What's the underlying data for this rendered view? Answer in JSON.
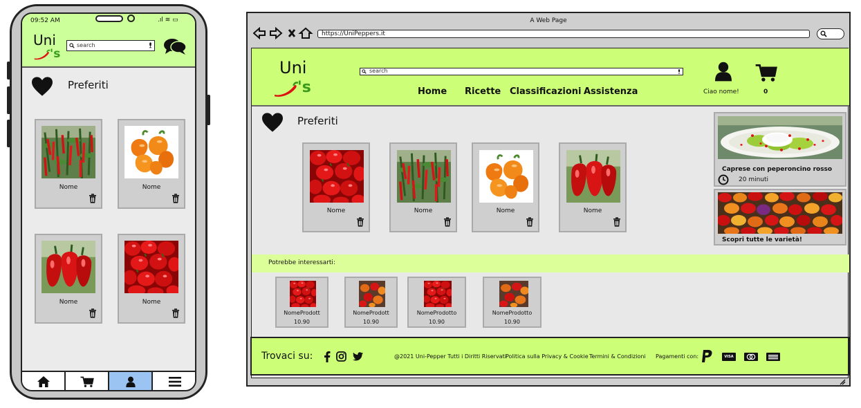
{
  "phone": {
    "status_time": "09:52 AM",
    "logo": {
      "top": "Uni",
      "bottom": "'s"
    },
    "search_placeholder": "search",
    "page_title": "Preferiti",
    "favorites": [
      {
        "name": "Nome",
        "image": "pepper-plant"
      },
      {
        "name": "Nome",
        "image": "orange-habanero"
      },
      {
        "name": "Nome",
        "image": "red-habanero"
      },
      {
        "name": "Nome",
        "image": "red-peppers-pile"
      }
    ],
    "bottom_nav": [
      "home-icon",
      "cart-icon",
      "user-icon",
      "menu-icon"
    ]
  },
  "browser": {
    "window_title": "A Web Page",
    "url": "https://UniPeppers.it",
    "logo": {
      "top": "Uni",
      "bottom": "'s"
    },
    "search_placeholder": "search",
    "nav": [
      "Home",
      "Ricette",
      "Classificazioni",
      "Assistenza"
    ],
    "user_greeting": "Ciao nome!",
    "cart_count": "0",
    "page_title": "Preferiti",
    "favorites": [
      {
        "name": "Nome",
        "image": "red-peppers-pile"
      },
      {
        "name": "Nome",
        "image": "pepper-plant"
      },
      {
        "name": "Nome",
        "image": "orange-habanero"
      },
      {
        "name": "Nome",
        "image": "red-habanero"
      }
    ],
    "sidebar": [
      {
        "title": "Caprese con peperoncino rosso",
        "time": "20 minuti",
        "image": "caprese-dish"
      },
      {
        "title": "Scopri tutte le varietà!",
        "image": "mixed-peppers"
      }
    ],
    "suggestions_title": "Potrebbe interessarti:",
    "suggestions": [
      {
        "name": "NomeProdott",
        "price": "10.90"
      },
      {
        "name": "NomeProdott",
        "price": "10.90"
      },
      {
        "name": "NomeProdotto",
        "price": "10.90"
      },
      {
        "name": "NomeProdotto",
        "price": "10.90"
      }
    ],
    "footer": {
      "follow": "Trovaci su:",
      "copyright": "@2021 Uni-Pepper Tutti i Diritti Riservati",
      "privacy": "Politica sulla Privacy & Cookie",
      "terms": "Termini & Condizioni",
      "payments_label": "Pagamenti con:",
      "payment_methods": [
        "PayPal",
        "VISA",
        "MasterCard",
        "AMEX"
      ]
    }
  },
  "colors": {
    "header_green": "#ccff77",
    "band_green": "#ddff99",
    "pepper_red": "#cc1111",
    "pepper_orange": "#ee7a11"
  }
}
